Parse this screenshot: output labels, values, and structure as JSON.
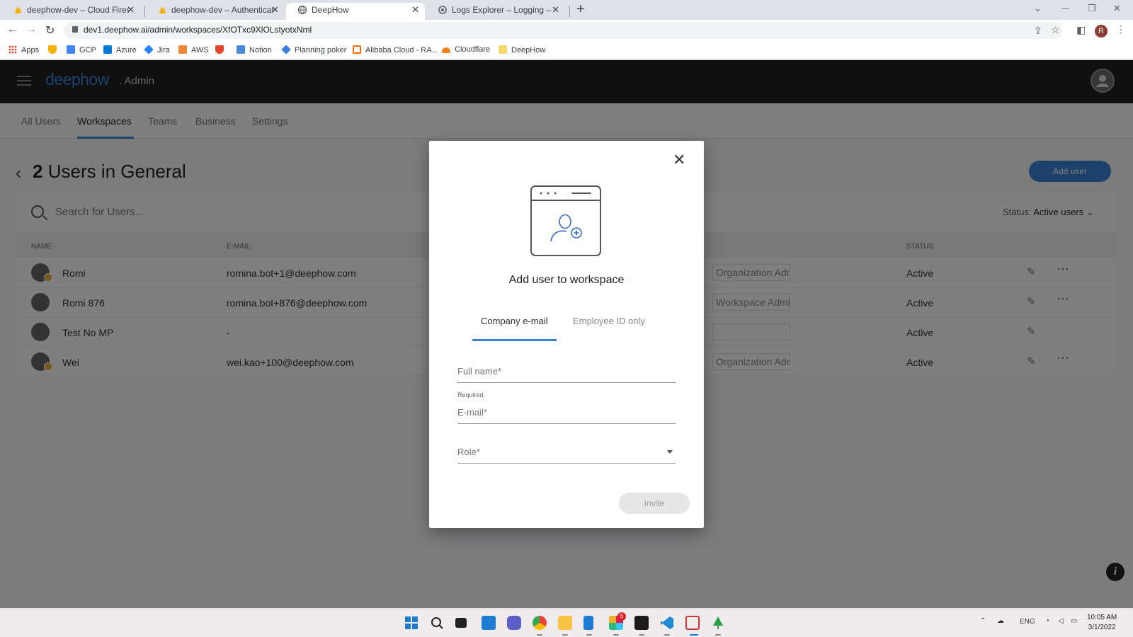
{
  "browser": {
    "tabs": [
      {
        "title": "deephow-dev – Cloud Firestore –",
        "icon": "firebase-icon",
        "active": false
      },
      {
        "title": "deephow-dev – Authentication –",
        "icon": "firebase-icon",
        "active": false
      },
      {
        "title": "DeepHow",
        "icon": "globe-icon",
        "active": true
      },
      {
        "title": "Logs Explorer – Logging – deeph",
        "icon": "gcp-logging-icon",
        "active": false
      }
    ],
    "url": "dev1.deephow.ai/admin/workspaces/XfOTxc9XlOLstyotxNml",
    "profile_initial": "R",
    "bookmarks": [
      {
        "label": "Apps",
        "icon": "apps-grid-icon",
        "color": "#e8453c"
      },
      {
        "label": "",
        "icon": "firebase-icon",
        "color": "#f6b100"
      },
      {
        "label": "GCP",
        "icon": "home-icon",
        "color": "#4285f4"
      },
      {
        "label": "Azure",
        "icon": "azure-icon",
        "color": "#0078d4"
      },
      {
        "label": "Jira",
        "icon": "jira-icon",
        "color": "#2684ff"
      },
      {
        "label": "AWS",
        "icon": "aws-icon",
        "color": "#f58536"
      },
      {
        "label": "",
        "icon": "gitlab-icon",
        "color": "#e24329"
      },
      {
        "label": "Notion",
        "icon": "monitor-icon",
        "color": "#4a8ad8"
      },
      {
        "label": "Planning poker",
        "icon": "planning-poker-icon",
        "color": "#3b7dd8"
      },
      {
        "label": "Alibaba Cloud - RA...",
        "icon": "alibaba-icon",
        "color": "#ff6a00"
      },
      {
        "label": "Cloudflare",
        "icon": "cloudflare-icon",
        "color": "#f38020"
      },
      {
        "label": "DeepHow",
        "icon": "folder-icon",
        "color": "#f6d86b"
      }
    ]
  },
  "app": {
    "logo": "deephow",
    "logo_suffix": ". Admin",
    "nav_tabs": [
      "All Users",
      "Workspaces",
      "Teams",
      "Business",
      "Settings"
    ],
    "active_tab": "Workspaces",
    "page_title_count": "2",
    "page_title_text": "Users in General",
    "add_user_label": "Add user",
    "search_placeholder": "Search for Users...",
    "status_filter_label": "Status:",
    "status_filter_value": "Active users",
    "table": {
      "headers": {
        "name": "NAME",
        "email": "E-MAIL",
        "status": "STATUS"
      },
      "rows": [
        {
          "name": "Romi",
          "email": "romina.bot+1@deephow.com",
          "role": "Organization Admin",
          "status": "Active",
          "badge": true,
          "more": true
        },
        {
          "name": "Romi 876",
          "email": "romina.bot+876@deephow.com",
          "role": "Workspace Admin",
          "status": "Active",
          "badge": false,
          "more": true
        },
        {
          "name": "Test No MP",
          "email": "-",
          "role": "",
          "status": "Active",
          "badge": false,
          "more": false
        },
        {
          "name": "Wei",
          "email": "wei.kao+100@deephow.com",
          "role": "Organization Admin",
          "status": "Active",
          "badge": true,
          "more": true
        }
      ]
    }
  },
  "dialog": {
    "title": "Add user to workspace",
    "tabs": [
      "Company e-mail",
      "Employee ID only"
    ],
    "active_tab": "Company e-mail",
    "fullname_placeholder": "Full name*",
    "fullname_hint": "Required.",
    "email_placeholder": "E-mail*",
    "role_placeholder": "Role*",
    "invite_label": "Invite"
  },
  "taskbar": {
    "tray_lang": "ENG",
    "time": "10:05 AM",
    "date": "3/1/2022",
    "slack_badge": "5"
  },
  "colors": {
    "accent": "#3b82d6",
    "appbar": "#1e1e1e",
    "badge_gold": "#f2b233"
  }
}
